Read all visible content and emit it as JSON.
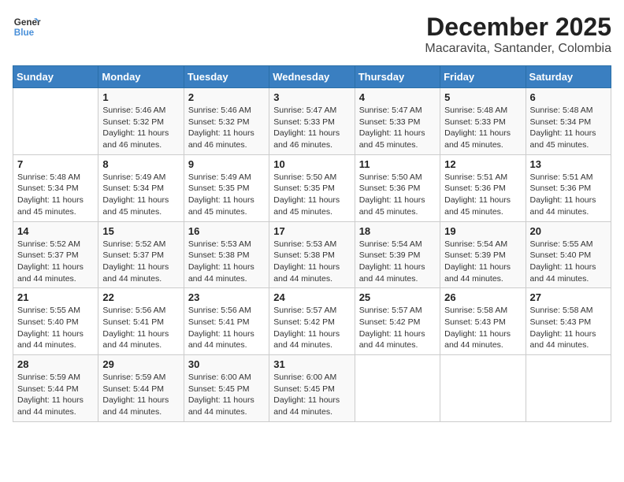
{
  "header": {
    "logo_line1": "General",
    "logo_line2": "Blue",
    "title": "December 2025",
    "subtitle": "Macaravita, Santander, Colombia"
  },
  "days_of_week": [
    "Sunday",
    "Monday",
    "Tuesday",
    "Wednesday",
    "Thursday",
    "Friday",
    "Saturday"
  ],
  "weeks": [
    [
      {
        "day": "",
        "info": ""
      },
      {
        "day": "1",
        "info": "Sunrise: 5:46 AM\nSunset: 5:32 PM\nDaylight: 11 hours\nand 46 minutes."
      },
      {
        "day": "2",
        "info": "Sunrise: 5:46 AM\nSunset: 5:32 PM\nDaylight: 11 hours\nand 46 minutes."
      },
      {
        "day": "3",
        "info": "Sunrise: 5:47 AM\nSunset: 5:33 PM\nDaylight: 11 hours\nand 46 minutes."
      },
      {
        "day": "4",
        "info": "Sunrise: 5:47 AM\nSunset: 5:33 PM\nDaylight: 11 hours\nand 45 minutes."
      },
      {
        "day": "5",
        "info": "Sunrise: 5:48 AM\nSunset: 5:33 PM\nDaylight: 11 hours\nand 45 minutes."
      },
      {
        "day": "6",
        "info": "Sunrise: 5:48 AM\nSunset: 5:34 PM\nDaylight: 11 hours\nand 45 minutes."
      }
    ],
    [
      {
        "day": "7",
        "info": "Sunrise: 5:48 AM\nSunset: 5:34 PM\nDaylight: 11 hours\nand 45 minutes."
      },
      {
        "day": "8",
        "info": "Sunrise: 5:49 AM\nSunset: 5:34 PM\nDaylight: 11 hours\nand 45 minutes."
      },
      {
        "day": "9",
        "info": "Sunrise: 5:49 AM\nSunset: 5:35 PM\nDaylight: 11 hours\nand 45 minutes."
      },
      {
        "day": "10",
        "info": "Sunrise: 5:50 AM\nSunset: 5:35 PM\nDaylight: 11 hours\nand 45 minutes."
      },
      {
        "day": "11",
        "info": "Sunrise: 5:50 AM\nSunset: 5:36 PM\nDaylight: 11 hours\nand 45 minutes."
      },
      {
        "day": "12",
        "info": "Sunrise: 5:51 AM\nSunset: 5:36 PM\nDaylight: 11 hours\nand 45 minutes."
      },
      {
        "day": "13",
        "info": "Sunrise: 5:51 AM\nSunset: 5:36 PM\nDaylight: 11 hours\nand 44 minutes."
      }
    ],
    [
      {
        "day": "14",
        "info": "Sunrise: 5:52 AM\nSunset: 5:37 PM\nDaylight: 11 hours\nand 44 minutes."
      },
      {
        "day": "15",
        "info": "Sunrise: 5:52 AM\nSunset: 5:37 PM\nDaylight: 11 hours\nand 44 minutes."
      },
      {
        "day": "16",
        "info": "Sunrise: 5:53 AM\nSunset: 5:38 PM\nDaylight: 11 hours\nand 44 minutes."
      },
      {
        "day": "17",
        "info": "Sunrise: 5:53 AM\nSunset: 5:38 PM\nDaylight: 11 hours\nand 44 minutes."
      },
      {
        "day": "18",
        "info": "Sunrise: 5:54 AM\nSunset: 5:39 PM\nDaylight: 11 hours\nand 44 minutes."
      },
      {
        "day": "19",
        "info": "Sunrise: 5:54 AM\nSunset: 5:39 PM\nDaylight: 11 hours\nand 44 minutes."
      },
      {
        "day": "20",
        "info": "Sunrise: 5:55 AM\nSunset: 5:40 PM\nDaylight: 11 hours\nand 44 minutes."
      }
    ],
    [
      {
        "day": "21",
        "info": "Sunrise: 5:55 AM\nSunset: 5:40 PM\nDaylight: 11 hours\nand 44 minutes."
      },
      {
        "day": "22",
        "info": "Sunrise: 5:56 AM\nSunset: 5:41 PM\nDaylight: 11 hours\nand 44 minutes."
      },
      {
        "day": "23",
        "info": "Sunrise: 5:56 AM\nSunset: 5:41 PM\nDaylight: 11 hours\nand 44 minutes."
      },
      {
        "day": "24",
        "info": "Sunrise: 5:57 AM\nSunset: 5:42 PM\nDaylight: 11 hours\nand 44 minutes."
      },
      {
        "day": "25",
        "info": "Sunrise: 5:57 AM\nSunset: 5:42 PM\nDaylight: 11 hours\nand 44 minutes."
      },
      {
        "day": "26",
        "info": "Sunrise: 5:58 AM\nSunset: 5:43 PM\nDaylight: 11 hours\nand 44 minutes."
      },
      {
        "day": "27",
        "info": "Sunrise: 5:58 AM\nSunset: 5:43 PM\nDaylight: 11 hours\nand 44 minutes."
      }
    ],
    [
      {
        "day": "28",
        "info": "Sunrise: 5:59 AM\nSunset: 5:44 PM\nDaylight: 11 hours\nand 44 minutes."
      },
      {
        "day": "29",
        "info": "Sunrise: 5:59 AM\nSunset: 5:44 PM\nDaylight: 11 hours\nand 44 minutes."
      },
      {
        "day": "30",
        "info": "Sunrise: 6:00 AM\nSunset: 5:45 PM\nDaylight: 11 hours\nand 44 minutes."
      },
      {
        "day": "31",
        "info": "Sunrise: 6:00 AM\nSunset: 5:45 PM\nDaylight: 11 hours\nand 44 minutes."
      },
      {
        "day": "",
        "info": ""
      },
      {
        "day": "",
        "info": ""
      },
      {
        "day": "",
        "info": ""
      }
    ]
  ]
}
